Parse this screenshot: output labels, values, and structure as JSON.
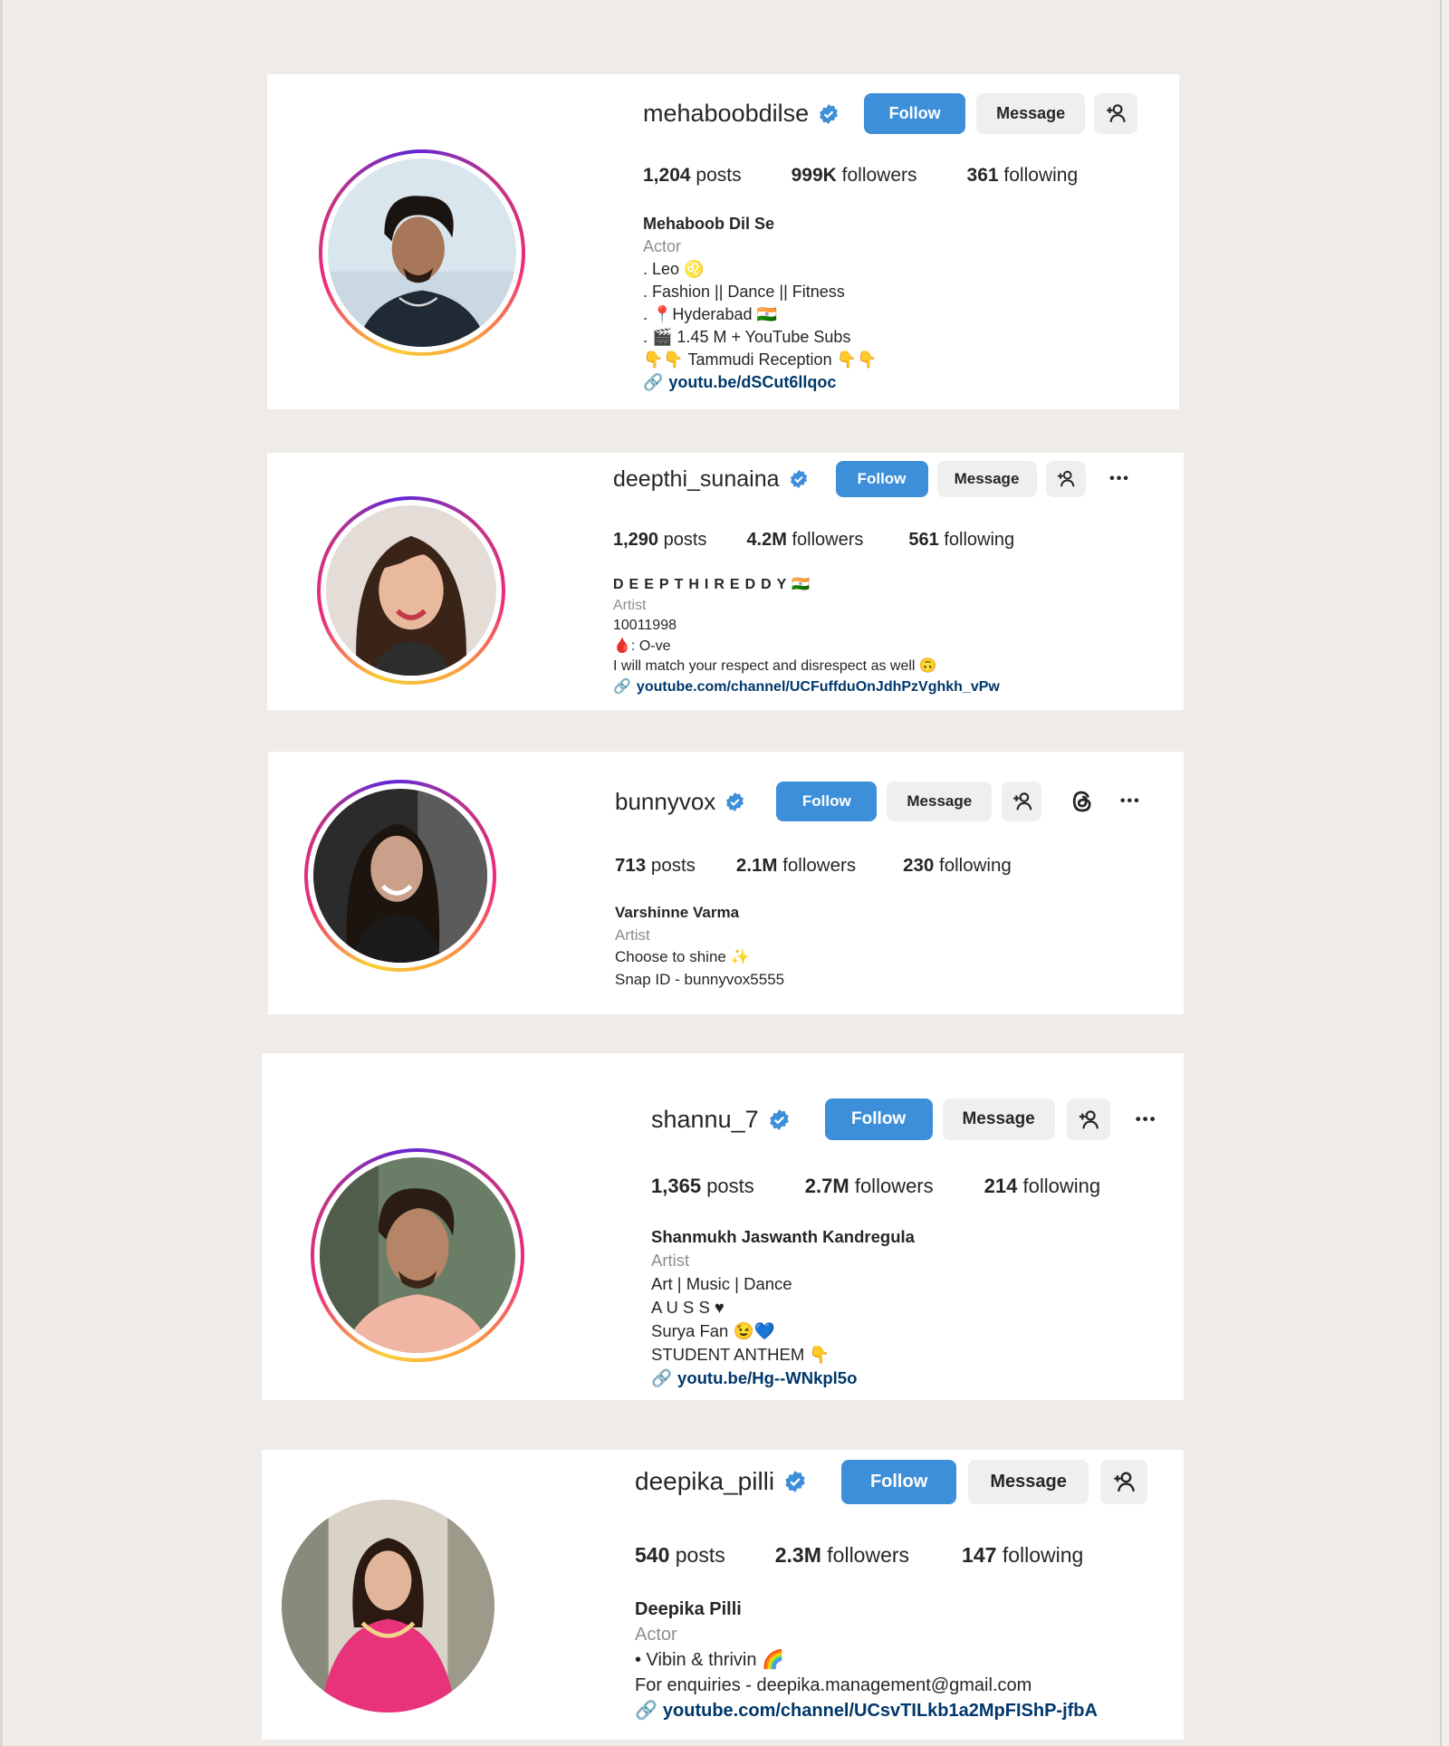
{
  "colors": {
    "page_background": "#eeebe8",
    "follow_button": "#3d8fd9",
    "verified_badge": "#3d8fd9",
    "secondary_button": "#efefef",
    "category_text": "#8e8e8e",
    "link_text": "#00376b"
  },
  "profiles": [
    {
      "username": "mehaboobdilse",
      "follow_label": "Follow",
      "message_label": "Message",
      "posts_count": "1,204",
      "posts_label": "posts",
      "followers_count": "999K",
      "followers_label": "followers",
      "following_count": "361",
      "following_label": "following",
      "display_name": "Mehaboob Dil Se",
      "category": "Actor",
      "bio": [
        ". Leo ♌",
        ". Fashion || Dance || Fitness",
        ". 📍Hyderabad 🇮🇳",
        ". 🎬 1.45 M + YouTube Subs",
        "👇👇 Tammudi Reception 👇👇"
      ],
      "link": "youtu.be/dSCut6llqoc",
      "icons": [
        "verified-badge-icon",
        "person-add-icon",
        "link-icon"
      ]
    },
    {
      "username": "deepthi_sunaina",
      "follow_label": "Follow",
      "message_label": "Message",
      "more_label": "•••",
      "posts_count": "1,290",
      "posts_label": "posts",
      "followers_count": "4.2M",
      "followers_label": "followers",
      "following_count": "561",
      "following_label": "following",
      "display_name": "DEEPTHIREDDY🇮🇳",
      "category": "Artist",
      "bio": [
        "10011998",
        "🩸: O-ve",
        "I will match your respect and disrespect as well 🙃"
      ],
      "link": "youtube.com/channel/UCFuffduOnJdhPzVghkh_vPw",
      "icons": [
        "verified-badge-icon",
        "person-add-icon",
        "more-options-icon",
        "link-icon"
      ]
    },
    {
      "username": "bunnyvox",
      "follow_label": "Follow",
      "message_label": "Message",
      "more_label": "•••",
      "posts_count": "713",
      "posts_label": "posts",
      "followers_count": "2.1M",
      "followers_label": "followers",
      "following_count": "230",
      "following_label": "following",
      "display_name": "Varshinne Varma",
      "category": "Artist",
      "bio": [
        "Choose to shine ✨",
        "Snap ID - bunnyvox5555"
      ],
      "icons": [
        "verified-badge-icon",
        "person-add-icon",
        "threads-icon",
        "more-options-icon"
      ]
    },
    {
      "username": "shannu_7",
      "follow_label": "Follow",
      "message_label": "Message",
      "more_label": "•••",
      "posts_count": "1,365",
      "posts_label": "posts",
      "followers_count": "2.7M",
      "followers_label": "followers",
      "following_count": "214",
      "following_label": "following",
      "display_name": "Shanmukh Jaswanth Kandregula",
      "category": "Artist",
      "bio": [
        "Art | Music | Dance",
        "A U S S ♥",
        "Surya Fan 😉💙",
        "STUDENT ANTHEM 👇"
      ],
      "link": "youtu.be/Hg--WNkpl5o",
      "icons": [
        "verified-badge-icon",
        "person-add-icon",
        "more-options-icon",
        "link-icon"
      ]
    },
    {
      "username": "deepika_pilli",
      "follow_label": "Follow",
      "message_label": "Message",
      "posts_count": "540",
      "posts_label": "posts",
      "followers_count": "2.3M",
      "followers_label": "followers",
      "following_count": "147",
      "following_label": "following",
      "display_name": "Deepika Pilli",
      "category": "Actor",
      "bio": [
        "• Vibin & thrivin 🌈",
        "For enquiries - deepika.management@gmail.com"
      ],
      "link": "youtube.com/channel/UCsvTILkb1a2MpFIShP-jfbA",
      "icons": [
        "verified-badge-icon",
        "person-add-icon",
        "link-icon"
      ]
    }
  ]
}
